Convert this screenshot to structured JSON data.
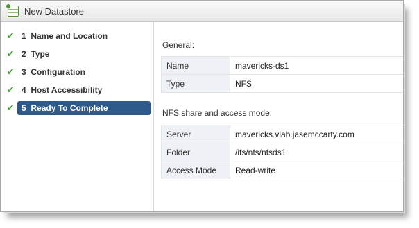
{
  "dialog": {
    "title": "New Datastore"
  },
  "steps": [
    {
      "number": "1",
      "label": "Name and Location",
      "done": true
    },
    {
      "number": "2",
      "label": "Type",
      "done": true
    },
    {
      "number": "3",
      "label": "Configuration",
      "done": true
    },
    {
      "number": "4",
      "label": "Host Accessibility",
      "done": true
    },
    {
      "number": "5",
      "label": "Ready To Complete",
      "done": true,
      "active": true
    }
  ],
  "general": {
    "title": "General:",
    "rows": [
      {
        "key": "Name",
        "value": "mavericks-ds1"
      },
      {
        "key": "Type",
        "value": "NFS"
      }
    ]
  },
  "nfs": {
    "title": "NFS share and access mode:",
    "rows": [
      {
        "key": "Server",
        "value": "mavericks.vlab.jasemccarty.com"
      },
      {
        "key": "Folder",
        "value": "/ifs/nfs/nfsds1"
      },
      {
        "key": "Access Mode",
        "value": "Read-write"
      }
    ]
  },
  "colors": {
    "active_step": "#2d5a8b",
    "check": "#3a9a2a",
    "key_cell": "#eef2f6"
  },
  "icons": {
    "title": "datastore-icon",
    "step_status": "checkmark-icon"
  }
}
